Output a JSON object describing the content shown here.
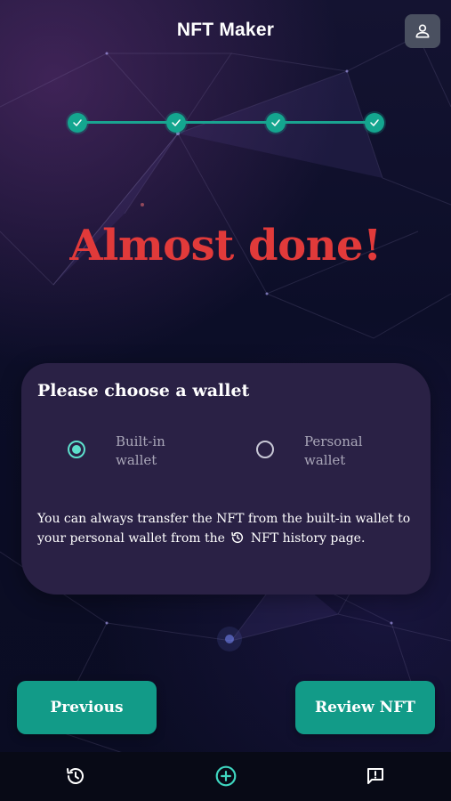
{
  "header": {
    "title": "NFT Maker",
    "profile_icon": "person-icon"
  },
  "stepper": {
    "steps_completed": 4,
    "steps_total": 4,
    "accent_color": "#14a68f"
  },
  "headline": "Almost done!",
  "wallet_card": {
    "title": "Please choose a wallet",
    "options": [
      {
        "label": "Built-in wallet",
        "selected": true
      },
      {
        "label": "Personal wallet",
        "selected": false
      }
    ],
    "note_before": "You can always transfer the NFT from the built-in wallet to your personal wallet from the",
    "note_icon": "history-icon",
    "note_after": "NFT history page."
  },
  "buttons": {
    "previous": "Previous",
    "review": "Review NFT"
  },
  "bottom_nav": {
    "items": [
      {
        "icon": "history-icon"
      },
      {
        "icon": "add-circle-icon",
        "active": true
      },
      {
        "icon": "feedback-icon"
      }
    ]
  },
  "colors": {
    "headline": "#e13a3a",
    "card": "#2a2145",
    "button": "#129b88",
    "radio_selected": "#5de0cc"
  }
}
